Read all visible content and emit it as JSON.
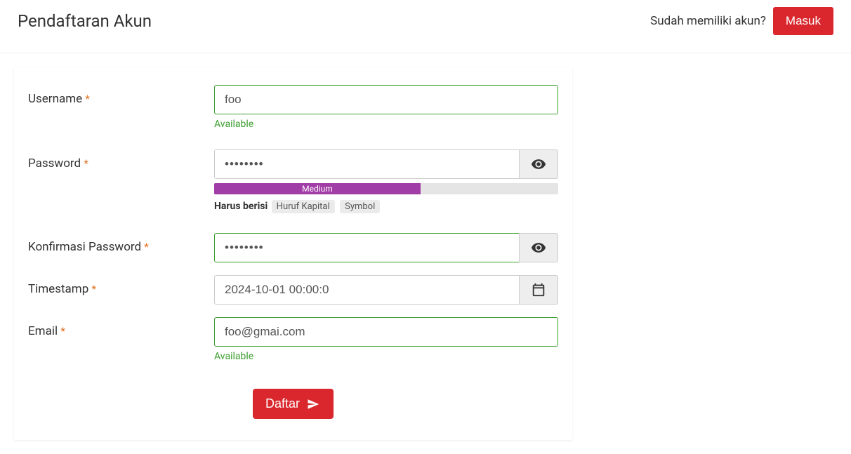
{
  "header": {
    "title": "Pendaftaran Akun",
    "already_text": "Sudah memiliki akun?",
    "login_button": "Masuk"
  },
  "form": {
    "username": {
      "label": "Username",
      "value": "foo",
      "hint": "Available"
    },
    "password": {
      "label": "Password",
      "value": "••••••••",
      "strength_label": "Medium",
      "strength_percent": 60,
      "requirements_label": "Harus berisi",
      "requirements": [
        "Huruf Kapital",
        "Symbol"
      ]
    },
    "confirm_password": {
      "label": "Konfirmasi Password",
      "value": "••••••••"
    },
    "timestamp": {
      "label": "Timestamp",
      "value": "2024-10-01 00:00:0"
    },
    "email": {
      "label": "Email",
      "value": "foo@gmai.com",
      "hint": "Available"
    },
    "submit_label": "Daftar"
  }
}
